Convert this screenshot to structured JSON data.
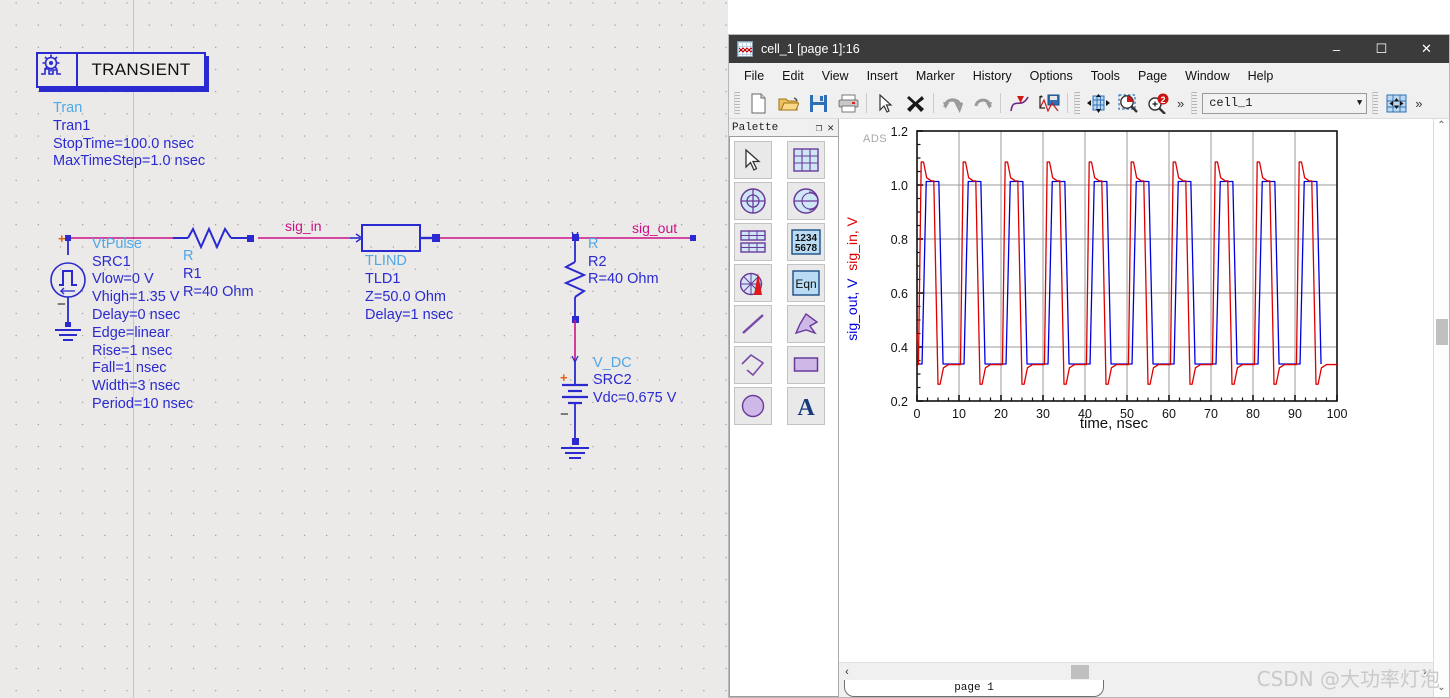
{
  "schematic": {
    "transient": {
      "icon_name": "transient-sim-icon",
      "label": "TRANSIENT",
      "lines": [
        "Tran",
        "Tran1",
        "StopTime=100.0 nsec",
        "MaxTimeStep=1.0 nsec"
      ]
    },
    "source_vtpulse": {
      "type": "VtPulse",
      "instance": "SRC1",
      "params": [
        "Vlow=0 V",
        "Vhigh=1.35 V",
        "Delay=0 nsec",
        "Edge=linear",
        "Rise=1 nsec",
        "Fall=1 nsec",
        "Width=3 nsec",
        "Period=10 nsec"
      ],
      "plus": "+",
      "minus": "−"
    },
    "resistor_r1": {
      "type": "R",
      "instance": "R1",
      "value": "R=40 Ohm"
    },
    "tline": {
      "type": "TLIND",
      "instance": "TLD1",
      "params": [
        "Z=50.0 Ohm",
        "Delay=1 nsec"
      ]
    },
    "resistor_r2": {
      "type": "R",
      "instance": "R2",
      "value": "R=40 Ohm"
    },
    "source_vdc": {
      "type": "V_DC",
      "instance": "SRC2",
      "value": "Vdc=0.675 V",
      "plus": "+",
      "minus": "−"
    },
    "nets": {
      "input": "sig_in",
      "output": "sig_out"
    },
    "colors": {
      "wire": "#2a2ad0",
      "net_wire": "#cc1188",
      "text_blue": "#2a2ad0",
      "text_cyan": "#4fa8e8",
      "background": "#eceae8"
    }
  },
  "window": {
    "title": "cell_1 [page 1]:16",
    "icon_name": "ads-data-display-icon",
    "buttons": {
      "minimize": "–",
      "maximize": "☐",
      "close": "✕"
    },
    "menu": [
      "File",
      "Edit",
      "View",
      "Insert",
      "Marker",
      "History",
      "Options",
      "Tools",
      "Page",
      "Window",
      "Help"
    ],
    "toolbar": {
      "icons": [
        "new-document-icon",
        "open-folder-icon",
        "save-disk-icon",
        "print-icon",
        "select-arrow-icon",
        "delete-x-icon",
        "undo-arrow-icon",
        "redo-arrow-icon",
        "trace-curve-icon",
        "insert-plot-icon",
        "pan-move-icon",
        "zoom-area-icon",
        "zoom-in-2-icon",
        "fit-page-icon"
      ],
      "overflow": "»",
      "cell_selector": "cell_1",
      "cell_selector_arrow": "▼"
    }
  },
  "palette": {
    "title": "Palette",
    "title_buttons": {
      "float": "❐",
      "close": "✕"
    },
    "tools": [
      "select-arrow-icon",
      "rectangular-plot-icon",
      "polar-plot-icon",
      "smith-chart-icon",
      "list-table-icon",
      "stacked-numbers-icon",
      "antenna-pattern-icon",
      "equation-eqn-icon",
      "line-tool-icon",
      "polygon-tool-icon",
      "polyline-tool-icon",
      "rectangle-tool-icon",
      "circle-tool-icon",
      "text-tool-icon"
    ],
    "eqn_label": "Eqn",
    "numbers_label_top": "1234",
    "numbers_label_bottom": "5678",
    "text_label": "A"
  },
  "plot": {
    "ads_logo": "ADS",
    "page_tab": "page 1",
    "scroll": {
      "left": "‹",
      "right": "›",
      "up": "⌃",
      "down": "⌄"
    }
  },
  "chart_data": {
    "type": "line",
    "title": "",
    "xlabel": "time, nsec",
    "ylabel_parts": [
      {
        "text": "sig_out, V",
        "color": "#0000dd"
      },
      {
        "text": "sig_in, V",
        "color": "#dd0000"
      }
    ],
    "xlim": [
      0,
      100
    ],
    "ylim": [
      0.2,
      1.2
    ],
    "xticks": [
      0,
      10,
      20,
      30,
      40,
      50,
      60,
      70,
      80,
      90,
      100
    ],
    "yticks": [
      0.2,
      0.4,
      0.6,
      0.8,
      1.0,
      1.2
    ],
    "grid": true,
    "legend": "none",
    "waveform": {
      "period_ns": 10,
      "pulse_width_ns": 3,
      "rise_ns": 1,
      "fall_ns": 1,
      "n_periods": 10
    },
    "series": [
      {
        "name": "sig_in, V",
        "color": "#dd0000",
        "description": "Input node voltage: overshoot peak 1.085 V, settles to 1.015 V, undershoot dip 0.262 V, settles to 0.335 V",
        "high_peak": 1.085,
        "high_settle": 1.015,
        "low_dip": 0.262,
        "low_settle": 0.335,
        "start_value": 0.45
      },
      {
        "name": "sig_out, V",
        "color": "#0000dd",
        "description": "Output node voltage after 1 nsec delay line: flat top 1.013 V, flat bottom 0.337 V",
        "high_level": 1.013,
        "low_level": 0.337,
        "delay_ns": 1.2
      }
    ]
  },
  "watermark": "CSDN @大功率灯泡"
}
